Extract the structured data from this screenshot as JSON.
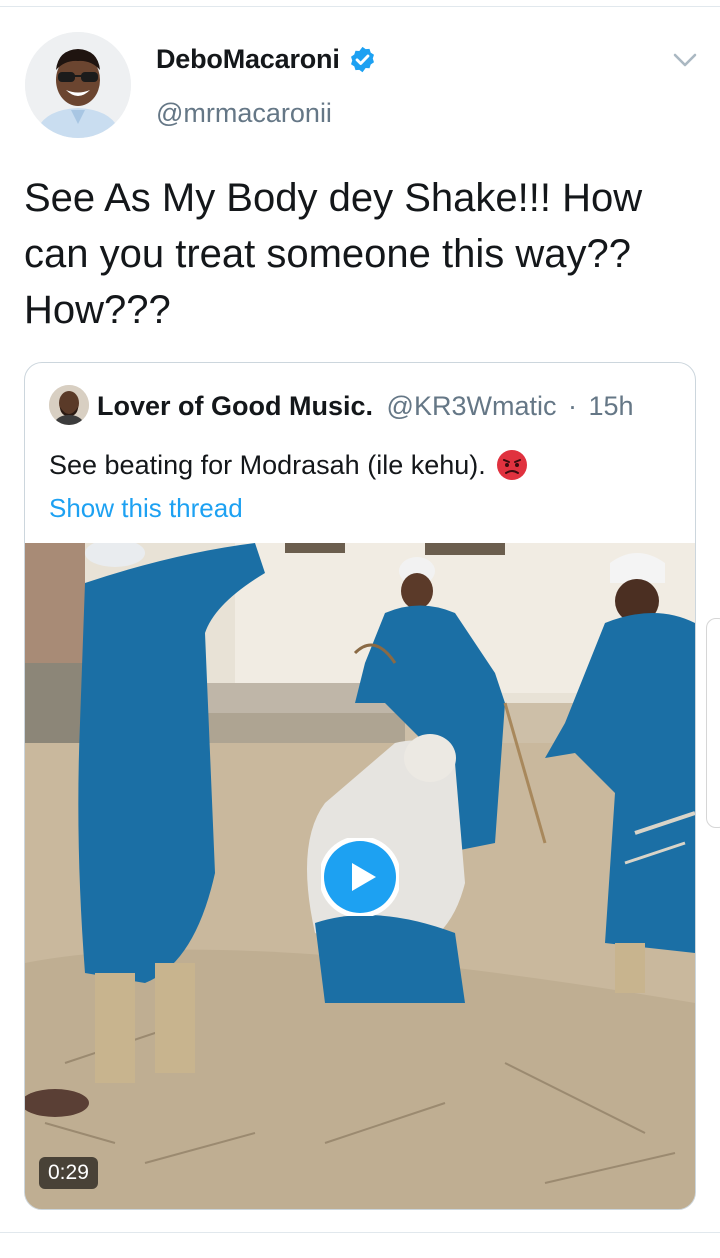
{
  "tweet": {
    "author": {
      "display_name": "DeboMacaroni",
      "handle": "@mrmacaronii",
      "verified": true
    },
    "text": "See As My Body dey Shake!!! How can you treat someone this way?? How???",
    "more_icon": "chevron-down-icon",
    "quoted": {
      "display_name": "Lover of Good Music.",
      "handle": "@KR3Wmatic",
      "separator": "·",
      "time": "15h",
      "text": "See beating for Modrasah (ile kehu).",
      "emoji": "angry-face-emoji",
      "show_thread_label": "Show this thread",
      "media": {
        "type": "video",
        "duration": "0:29",
        "play_icon": "play-icon"
      }
    }
  },
  "colors": {
    "accent": "#1da1f2",
    "secondary_text": "#657786",
    "primary_text": "#14171a",
    "border": "#ccd6dd"
  }
}
